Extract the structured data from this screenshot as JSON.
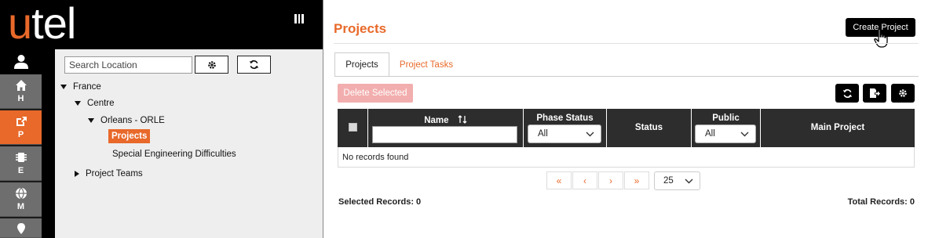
{
  "logo": {
    "first": "u",
    "rest": "tel"
  },
  "rail": [
    {
      "letter": "H",
      "icon": "home-icon"
    },
    {
      "letter": "P",
      "icon": "share-icon",
      "active": true
    },
    {
      "letter": "E",
      "icon": "chip-icon"
    },
    {
      "letter": "M",
      "icon": "globe-icon"
    }
  ],
  "tree": {
    "search_placeholder": "Search Location",
    "nodes": {
      "france": "France",
      "centre": "Centre",
      "orleans": "Orleans - ORLE",
      "projects": "Projects",
      "special": "Special Engineering Difficulties",
      "project_teams": "Project Teams"
    }
  },
  "page": {
    "title": "Projects",
    "create_button": "Create Project",
    "tabs": {
      "projects": "Projects",
      "project_tasks": "Project Tasks"
    },
    "delete_button": "Delete Selected"
  },
  "grid": {
    "columns": {
      "name": "Name",
      "phase_status": "Phase Status",
      "status": "Status",
      "public": "Public",
      "main_project": "Main Project"
    },
    "phase_filter": "All",
    "public_filter": "All",
    "empty_text": "No records found"
  },
  "pager": {
    "first": "«",
    "prev": "‹",
    "next": "›",
    "last": "»",
    "page_size": "25"
  },
  "footer": {
    "selected": "Selected Records: 0",
    "total": "Total Records: 0"
  },
  "colors": {
    "accent": "#e8692a",
    "header_bg": "#2d2d2d",
    "delete_disabled": "#f2aeae"
  }
}
